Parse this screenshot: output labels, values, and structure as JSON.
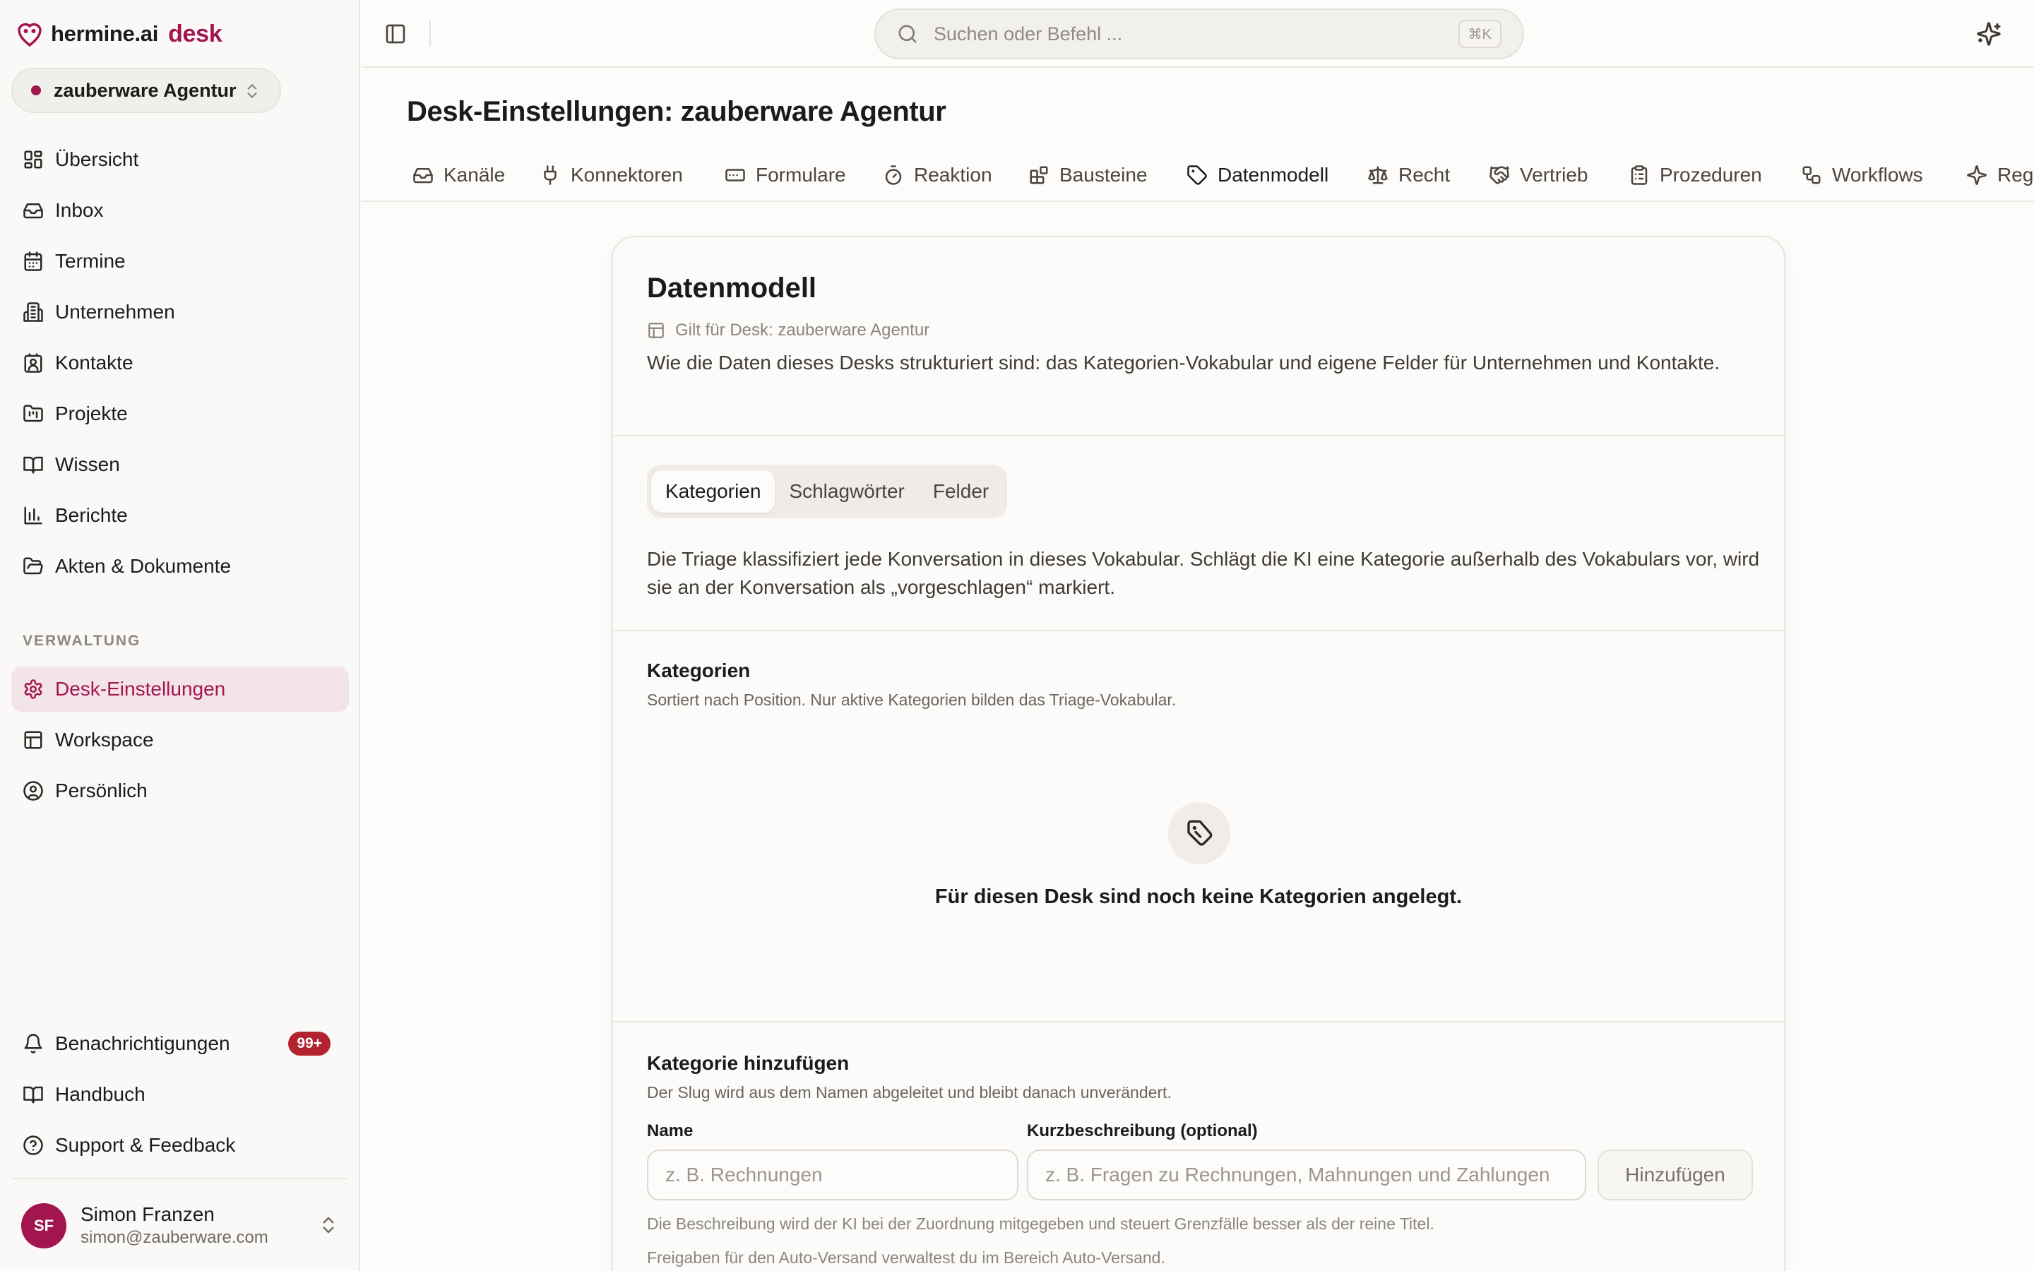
{
  "brand": {
    "name": "hermine.ai",
    "suffix": "desk"
  },
  "desk_switcher": {
    "label": "zauberware Agentur"
  },
  "sidebar": {
    "nav": [
      {
        "label": "Übersicht",
        "icon": "dashboard-icon"
      },
      {
        "label": "Inbox",
        "icon": "inbox-icon"
      },
      {
        "label": "Termine",
        "icon": "calendar-icon"
      },
      {
        "label": "Unternehmen",
        "icon": "building-icon"
      },
      {
        "label": "Kontakte",
        "icon": "contact-icon"
      },
      {
        "label": "Projekte",
        "icon": "folder-kanban-icon"
      },
      {
        "label": "Wissen",
        "icon": "book-open-icon"
      },
      {
        "label": "Berichte",
        "icon": "bar-chart-icon"
      },
      {
        "label": "Akten & Dokumente",
        "icon": "folder-open-icon"
      }
    ],
    "section_label": "VERWALTUNG",
    "admin": [
      {
        "label": "Desk-Einstellungen",
        "icon": "gear-icon",
        "active": true
      },
      {
        "label": "Workspace",
        "icon": "layout-icon"
      },
      {
        "label": "Persönlich",
        "icon": "user-circle-icon"
      }
    ],
    "bottom": [
      {
        "label": "Benachrichtigungen",
        "icon": "bell-icon",
        "badge": "99+"
      },
      {
        "label": "Handbuch",
        "icon": "book-icon"
      },
      {
        "label": "Support & Feedback",
        "icon": "help-circle-icon"
      }
    ],
    "user": {
      "initials": "SF",
      "name": "Simon Franzen",
      "email": "simon@zauberware.com"
    }
  },
  "topbar": {
    "search_placeholder": "Suchen oder Befehl ...",
    "shortcut": "⌘K"
  },
  "page": {
    "title": "Desk-Einstellungen: zauberware Agentur",
    "tabs": [
      {
        "label": "Kanäle",
        "icon": "inbox-icon"
      },
      {
        "label": "Konnektoren",
        "icon": "plug-icon"
      },
      {
        "label": "Formulare",
        "icon": "form-icon"
      },
      {
        "label": "Reaktion",
        "icon": "timer-icon"
      },
      {
        "label": "Bausteine",
        "icon": "blocks-icon"
      },
      {
        "label": "Datenmodell",
        "icon": "tags-icon",
        "active": true
      },
      {
        "label": "Recht",
        "icon": "scale-icon"
      },
      {
        "label": "Vertrieb",
        "icon": "handshake-icon"
      },
      {
        "label": "Prozeduren",
        "icon": "clipboard-icon"
      },
      {
        "label": "Workflows",
        "icon": "workflow-icon"
      },
      {
        "label": "Regeln",
        "icon": "sparkles-icon"
      }
    ]
  },
  "card": {
    "title": "Datenmodell",
    "applies_to": "Gilt für Desk: zauberware Agentur",
    "description": "Wie die Daten dieses Desks strukturiert sind: das Kategorien-Vokabular und eigene Felder für Unternehmen und Kontakte.",
    "segments": [
      "Kategorien",
      "Schlagwörter",
      "Felder"
    ],
    "active_segment": "Kategorien",
    "triage_description": "Die Triage klassifiziert jede Konversation in dieses Vokabular. Schlägt die KI eine Kategorie außerhalb des Vokabulars vor, wird sie an der Konversation als „vorgeschlagen“ markiert.",
    "categories": {
      "title": "Kategorien",
      "subtitle": "Sortiert nach Position. Nur aktive Kategorien bilden das Triage-Vokabular.",
      "empty_text": "Für diesen Desk sind noch keine Kategorien angelegt."
    },
    "add": {
      "title": "Kategorie hinzufügen",
      "subtitle": "Der Slug wird aus dem Namen abgeleitet und bleibt danach unverändert.",
      "name_label": "Name",
      "name_placeholder": "z. B. Rechnungen",
      "desc_label": "Kurzbeschreibung (optional)",
      "desc_placeholder": "z. B. Fragen zu Rechnungen, Mahnungen und Zahlungen",
      "button": "Hinzufügen",
      "hint1": "Die Beschreibung wird der KI bei der Zuordnung mitgegeben und steuert Grenzfälle besser als der reine Titel.",
      "hint2": "Freigaben für den Auto-Versand verwaltest du im Bereich Auto-Versand."
    }
  }
}
